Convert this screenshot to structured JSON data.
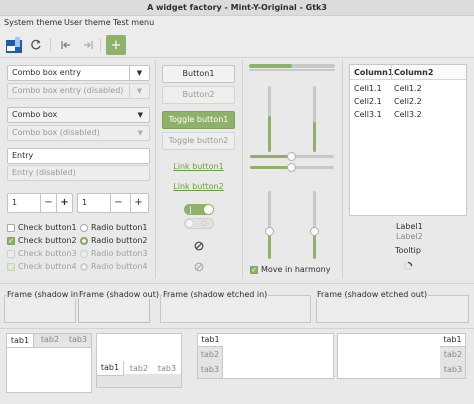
{
  "window": {
    "title": "A widget factory - Mint-Y-Original - Gtk3"
  },
  "menu": [
    "System theme",
    "User theme",
    "Test menu"
  ],
  "toolbar": {
    "add_label": "+"
  },
  "combos": {
    "entry": "Combo box entry",
    "entry_disabled": "Combo box entry (disabled)",
    "box": "Combo box",
    "box_disabled": "Combo box (disabled)"
  },
  "entries": {
    "entry": "Entry",
    "entry_disabled": "Entry (disabled)"
  },
  "spins": [
    {
      "value": "1",
      "minus": "−",
      "plus": "+"
    },
    {
      "value": "1",
      "minus": "−",
      "plus": "+"
    }
  ],
  "checks": [
    {
      "label": "Check button1",
      "state": "unchecked"
    },
    {
      "label": "Check button2",
      "state": "checked"
    },
    {
      "label": "Check button3",
      "state": "disabled"
    },
    {
      "label": "Check button4",
      "state": "disabled-checked"
    }
  ],
  "radios": [
    {
      "label": "Radio button1",
      "state": "off"
    },
    {
      "label": "Radio button2",
      "state": "on"
    },
    {
      "label": "Radio button3",
      "state": "disabled"
    },
    {
      "label": "Radio button4",
      "state": "disabled-on"
    }
  ],
  "buttons": {
    "button1": "Button1",
    "button2": "Button2",
    "toggle1": "Toggle button1",
    "toggle2": "Toggle button2",
    "link1": "Link button1",
    "link2": "Link button2"
  },
  "switches": [
    {
      "state": "on"
    },
    {
      "state": "off-disabled"
    }
  ],
  "sliders": {
    "move_in_harmony_label": "Move in harmony",
    "move_in_harmony_checked": true,
    "progress_top": 0.5,
    "h_scale_1": 0.5,
    "h_scale_2": 0.5,
    "v_left_1": 0.55,
    "v_left_2": 0.45,
    "v_bottom_1": 0.4,
    "v_bottom_2": 0.4
  },
  "tree": {
    "columns": [
      "Column1",
      "Column2"
    ],
    "rows": [
      [
        "Cell1.1",
        "Cell1.2"
      ],
      [
        "Cell2.1",
        "Cell2.2"
      ],
      [
        "Cell3.1",
        "Cell3.2"
      ]
    ]
  },
  "labels": {
    "label1": "Label1",
    "label2": "Label2",
    "tooltip": "Tooltip"
  },
  "frames": [
    "Frame (shadow in)",
    "Frame (shadow out)",
    "Frame (shadow etched in)",
    "Frame (shadow etched out)"
  ],
  "notebooks": {
    "tabs_top": [
      "tab1",
      "tab2",
      "tab3"
    ],
    "tabs_bottom": [
      "tab1",
      "tab2",
      "tab3"
    ],
    "tabs_left": [
      "tab1",
      "tab2",
      "tab3"
    ],
    "tabs_right": [
      "tab1",
      "tab2",
      "tab3"
    ]
  },
  "colors": {
    "accent": "#8fb26a",
    "accent_dark": "#7fa35b",
    "link": "#6e9a3e"
  }
}
